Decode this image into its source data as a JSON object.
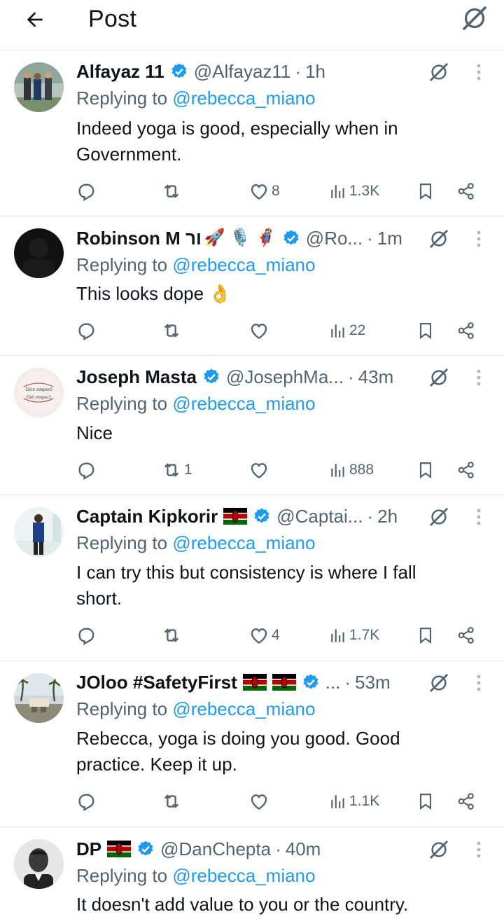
{
  "header": {
    "title": "Post"
  },
  "replying_label": "Replying to",
  "tweets": [
    {
      "name": "Alfayaz 11",
      "handle": "@Alfayaz11",
      "time": "1h",
      "reply_to": "@rebecca_miano",
      "text": "Indeed yoga is good, especially when in Government.",
      "replies": "",
      "reposts": "",
      "likes": "8",
      "views": "1.3K"
    },
    {
      "name": "Robinson M ור",
      "emojis": "🚀 🎙️ 🦸",
      "handle": "@Ro...",
      "time": "1m",
      "reply_to": "@rebecca_miano",
      "text": "This looks dope 👌",
      "replies": "",
      "reposts": "",
      "likes": "",
      "views": "22"
    },
    {
      "name": "Joseph Masta",
      "handle": "@JosephMa...",
      "time": "43m",
      "reply_to": "@rebecca_miano",
      "text": "Nice",
      "avatar_text": [
        "Give respect",
        "Get respect"
      ],
      "replies": "",
      "reposts": "1",
      "likes": "",
      "views": "888"
    },
    {
      "name": "Captain Kipkorir",
      "handle": "@Captai...",
      "time": "2h",
      "reply_to": "@rebecca_miano",
      "text": "I can try this but consistency is where I fall short.",
      "replies": "",
      "reposts": "",
      "likes": "4",
      "views": "1.7K"
    },
    {
      "name": "JOloo #SafetyFirst",
      "handle": "...",
      "time": "53m",
      "reply_to": "@rebecca_miano",
      "text": "Rebecca, yoga is doing you good. Good practice. Keep it up.",
      "replies": "",
      "reposts": "",
      "likes": "",
      "views": "1.1K"
    },
    {
      "name": "DP",
      "handle": "@DanChepta",
      "time": "40m",
      "reply_to": "@rebecca_miano",
      "text": "It doesn't add value to you or the country."
    }
  ],
  "colors": {
    "link": "#1d9bf0",
    "muted": "#536471",
    "text": "#0f1419",
    "divider": "#e6e9ea",
    "verified": "#1d9bf0"
  },
  "icons": [
    "back-arrow-icon",
    "grok-icon",
    "more-vertical-icon",
    "verified-badge-icon",
    "kenya-flag-icon",
    "reply-icon",
    "repost-icon",
    "like-icon",
    "views-icon",
    "bookmark-icon",
    "share-icon"
  ]
}
